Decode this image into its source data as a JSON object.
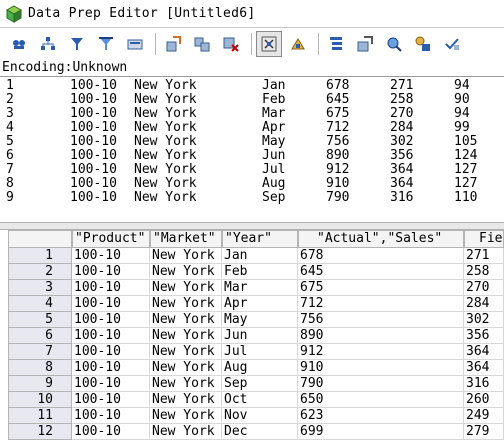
{
  "window": {
    "title": "Data Prep Editor [Untitled6]"
  },
  "toolbar": {
    "buttons": [
      {
        "name": "dimension-build-icon"
      },
      {
        "name": "hierarchy-icon"
      },
      {
        "name": "filter-icon"
      },
      {
        "name": "filter-alt-icon"
      },
      {
        "name": "field-properties-icon"
      },
      {
        "name": "move-field-icon"
      },
      {
        "name": "join-fields-icon"
      },
      {
        "name": "delete-field-icon"
      },
      {
        "name": "select-record-icon",
        "active": true
      },
      {
        "name": "replace-icon"
      },
      {
        "name": "outline-icon"
      },
      {
        "name": "dimension-properties-icon"
      },
      {
        "name": "associate-outline-icon"
      },
      {
        "name": "data-load-settings-icon"
      },
      {
        "name": "validate-icon"
      }
    ]
  },
  "encoding": {
    "label": "Encoding:Unknown"
  },
  "raw": {
    "rows": [
      {
        "num": "1",
        "product": "100-10",
        "market": "New York",
        "month": "Jan",
        "actual": "678",
        "sales": "271",
        "extra": "94"
      },
      {
        "num": "2",
        "product": "100-10",
        "market": "New York",
        "month": "Feb",
        "actual": "645",
        "sales": "258",
        "extra": "90"
      },
      {
        "num": "3",
        "product": "100-10",
        "market": "New York",
        "month": "Mar",
        "actual": "675",
        "sales": "270",
        "extra": "94"
      },
      {
        "num": "4",
        "product": "100-10",
        "market": "New York",
        "month": "Apr",
        "actual": "712",
        "sales": "284",
        "extra": "99"
      },
      {
        "num": "5",
        "product": "100-10",
        "market": "New York",
        "month": "May",
        "actual": "756",
        "sales": "302",
        "extra": "105"
      },
      {
        "num": "6",
        "product": "100-10",
        "market": "New York",
        "month": "Jun",
        "actual": "890",
        "sales": "356",
        "extra": "124"
      },
      {
        "num": "7",
        "product": "100-10",
        "market": "New York",
        "month": "Jul",
        "actual": "912",
        "sales": "364",
        "extra": "127"
      },
      {
        "num": "8",
        "product": "100-10",
        "market": "New York",
        "month": "Aug",
        "actual": "910",
        "sales": "364",
        "extra": "127"
      },
      {
        "num": "9",
        "product": "100-10",
        "market": "New York",
        "month": "Sep",
        "actual": "790",
        "sales": "316",
        "extra": "110"
      }
    ]
  },
  "grid": {
    "headers": [
      "\"Product\"",
      "\"Market\"",
      "\"Year\"",
      "\"Actual\",\"Sales\"",
      "Fie"
    ],
    "rows": [
      {
        "num": "1",
        "product": "100-10",
        "market": "New York",
        "year": "Jan",
        "actual": "678",
        "sales": "271"
      },
      {
        "num": "2",
        "product": "100-10",
        "market": "New York",
        "year": "Feb",
        "actual": "645",
        "sales": "258"
      },
      {
        "num": "3",
        "product": "100-10",
        "market": "New York",
        "year": "Mar",
        "actual": "675",
        "sales": "270"
      },
      {
        "num": "4",
        "product": "100-10",
        "market": "New York",
        "year": "Apr",
        "actual": "712",
        "sales": "284"
      },
      {
        "num": "5",
        "product": "100-10",
        "market": "New York",
        "year": "May",
        "actual": "756",
        "sales": "302"
      },
      {
        "num": "6",
        "product": "100-10",
        "market": "New York",
        "year": "Jun",
        "actual": "890",
        "sales": "356"
      },
      {
        "num": "7",
        "product": "100-10",
        "market": "New York",
        "year": "Jul",
        "actual": "912",
        "sales": "364"
      },
      {
        "num": "8",
        "product": "100-10",
        "market": "New York",
        "year": "Aug",
        "actual": "910",
        "sales": "364"
      },
      {
        "num": "9",
        "product": "100-10",
        "market": "New York",
        "year": "Sep",
        "actual": "790",
        "sales": "316"
      },
      {
        "num": "10",
        "product": "100-10",
        "market": "New York",
        "year": "Oct",
        "actual": "650",
        "sales": "260"
      },
      {
        "num": "11",
        "product": "100-10",
        "market": "New York",
        "year": "Nov",
        "actual": "623",
        "sales": "249"
      },
      {
        "num": "12",
        "product": "100-10",
        "market": "New York",
        "year": "Dec",
        "actual": "699",
        "sales": "279"
      }
    ]
  }
}
